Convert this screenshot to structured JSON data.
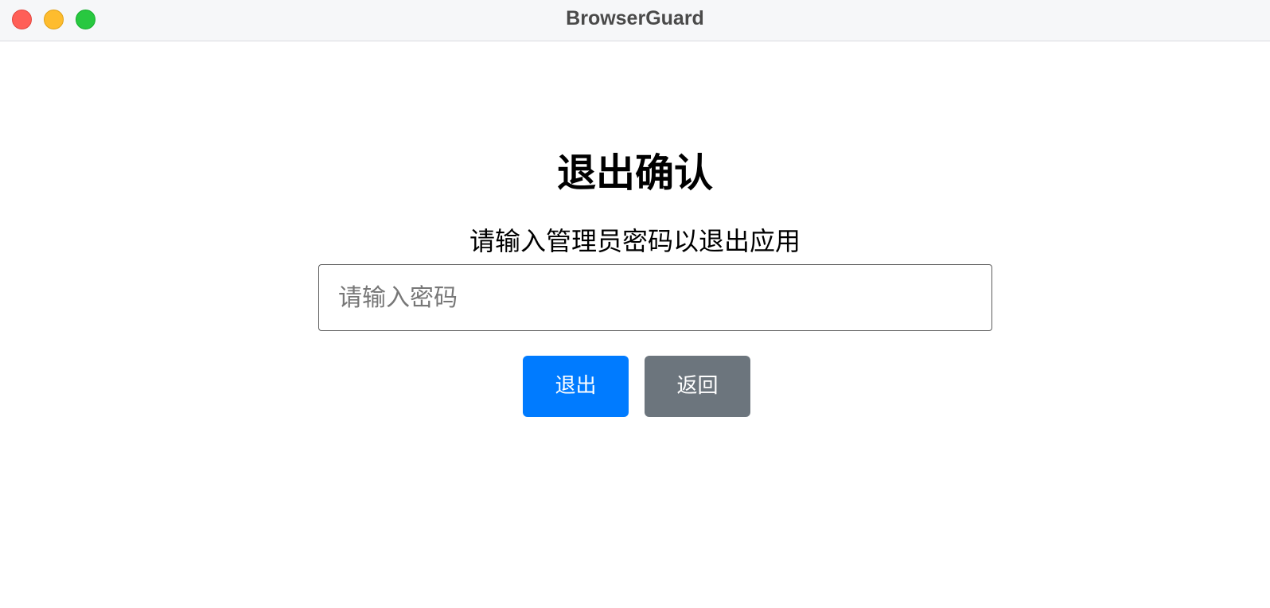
{
  "window": {
    "title": "BrowserGuard"
  },
  "dialog": {
    "heading": "退出确认",
    "message": "请输入管理员密码以退出应用",
    "password_placeholder": "请输入密码",
    "password_value": "",
    "exit_label": "退出",
    "back_label": "返回"
  },
  "colors": {
    "primary": "#007bff",
    "secondary": "#6c757d",
    "close": "#ff5f57",
    "minimize": "#febc2e",
    "zoom": "#28c840"
  },
  "icons": {
    "close": "close-icon",
    "minimize": "minimize-icon",
    "zoom": "zoom-icon"
  }
}
